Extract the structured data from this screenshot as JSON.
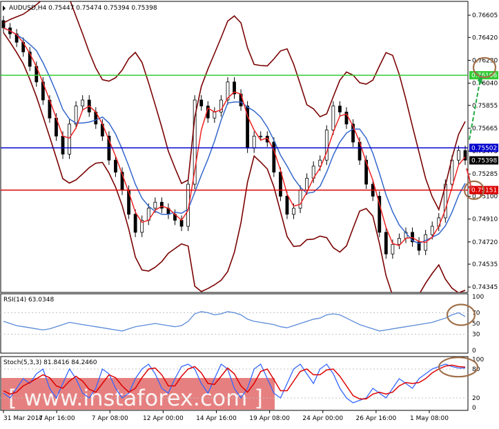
{
  "chart_data": [
    {
      "type": "candlestick",
      "panel": "main",
      "header": "AUDUSD,H4  0.75447 0.75474 0.75394 0.75398",
      "ylim": [
        0.743,
        0.7672
      ],
      "y_ticks": [
        "0.76605",
        "0.76420",
        "0.76230",
        "0.76040",
        "0.75855",
        "0.75665",
        "0.75475",
        "0.75285",
        "0.75100",
        "0.74910",
        "0.74720",
        "0.74535",
        "0.74345"
      ],
      "levels": [
        {
          "price": 0.76106,
          "label": "0.76106",
          "color": "#33cc33"
        },
        {
          "price": 0.75502,
          "label": "0.75502",
          "color": "#0000cc"
        },
        {
          "price": 0.75151,
          "label": "0.75151",
          "color": "#dd0000"
        }
      ],
      "current_price": {
        "price": 0.75398,
        "label": "0.75398"
      },
      "bollinger": {
        "upper_color": "#7a0000",
        "lower_color": "#7a0000"
      },
      "ma_fast_color": "#ee2222",
      "ma_slow_color": "#3366cc",
      "close": [
        0.765,
        0.7645,
        0.7638,
        0.763,
        0.7618,
        0.7605,
        0.759,
        0.7575,
        0.756,
        0.7545,
        0.757,
        0.7585,
        0.759,
        0.758,
        0.757,
        0.756,
        0.754,
        0.753,
        0.7515,
        0.7495,
        0.748,
        0.749,
        0.75,
        0.7505,
        0.75,
        0.7495,
        0.749,
        0.7485,
        0.752,
        0.759,
        0.7585,
        0.7575,
        0.758,
        0.759,
        0.7605,
        0.7595,
        0.7585,
        0.755,
        0.756,
        0.756,
        0.7555,
        0.753,
        0.751,
        0.7495,
        0.75,
        0.7515,
        0.7525,
        0.7535,
        0.754,
        0.7565,
        0.7585,
        0.758,
        0.757,
        0.7555,
        0.754,
        0.752,
        0.751,
        0.748,
        0.7462,
        0.747,
        0.7475,
        0.748,
        0.7472,
        0.7465,
        0.7478,
        0.7485,
        0.7492,
        0.752,
        0.754,
        0.7548,
        0.754
      ],
      "annotations": [
        {
          "type": "circle",
          "near": "0.76106",
          "color": "#a0704a"
        },
        {
          "type": "arrow-up",
          "color": "#22aa44"
        },
        {
          "type": "circle",
          "near": "0.75151",
          "color": "#a0704a"
        },
        {
          "type": "arrow-down",
          "color": "#dd3333"
        }
      ]
    },
    {
      "type": "line",
      "panel": "rsi",
      "header": "RSI(14) 63.0348",
      "ylim": [
        0,
        100
      ],
      "y_ticks": [
        "100",
        "70",
        "50",
        "30",
        "0"
      ],
      "series": [
        {
          "values": [
            54,
            50,
            46,
            44,
            42,
            40,
            38,
            40,
            44,
            48,
            52,
            50,
            48,
            46,
            44,
            42,
            40,
            38,
            36,
            40,
            44,
            46,
            48,
            50,
            48,
            46,
            44,
            46,
            54,
            68,
            72,
            70,
            66,
            68,
            72,
            70,
            66,
            58,
            54,
            52,
            50,
            48,
            44,
            42,
            46,
            50,
            54,
            58,
            60,
            66,
            68,
            66,
            60,
            54,
            48,
            44,
            40,
            36,
            38,
            40,
            42,
            44,
            46,
            48,
            50,
            52,
            56,
            60,
            66,
            70,
            63
          ]
        }
      ]
    },
    {
      "type": "line",
      "panel": "stochastic",
      "header": "Stoch(5,3,3) 81.8416 84.2460",
      "ylim": [
        0,
        100
      ],
      "y_ticks": [
        "100",
        "80",
        "20",
        "0"
      ],
      "series": [
        {
          "values": [
            30,
            20,
            40,
            60,
            50,
            70,
            80,
            40,
            20,
            50,
            80,
            60,
            30,
            20,
            40,
            80,
            70,
            40,
            20,
            30,
            60,
            80,
            90,
            70,
            40,
            30,
            60,
            85,
            90,
            80,
            50,
            30,
            60,
            90,
            80,
            40,
            20,
            40,
            80,
            90,
            60,
            30,
            20,
            50,
            80,
            90,
            70,
            50,
            80,
            90,
            70,
            40,
            20,
            10,
            15,
            20,
            40,
            30,
            20,
            40,
            60,
            50,
            40,
            60,
            70,
            80,
            85,
            90,
            85,
            82,
            82
          ]
        },
        {
          "values": [
            35,
            28,
            32,
            45,
            52,
            60,
            68,
            62,
            45,
            40,
            55,
            65,
            55,
            38,
            32,
            50,
            68,
            62,
            45,
            32,
            40,
            62,
            80,
            82,
            68,
            45,
            45,
            65,
            80,
            85,
            72,
            50,
            48,
            65,
            82,
            70,
            45,
            32,
            50,
            75,
            80,
            58,
            35,
            35,
            55,
            75,
            80,
            68,
            68,
            78,
            80,
            65,
            45,
            25,
            18,
            18,
            28,
            32,
            28,
            32,
            45,
            52,
            50,
            52,
            60,
            72,
            80,
            86,
            88,
            85,
            84
          ]
        }
      ]
    }
  ],
  "x_ticks": [
    "31 Mar 2017",
    "4 Apr 16:00",
    "7 Apr 08:00",
    "12 Apr 00:00",
    "14 Apr 16:00",
    "19 Apr 08:00",
    "24 Apr 00:00",
    "26 Apr 16:00",
    "1 May 08:00"
  ],
  "watermark": "[ www.instaforex.com ]",
  "chart_colors": {
    "grid": "#c0c0c0",
    "candle": "#000000",
    "rsi_line": "#5a8ad8",
    "stoch_main": "#3366ff",
    "stoch_signal": "#dd0000"
  }
}
